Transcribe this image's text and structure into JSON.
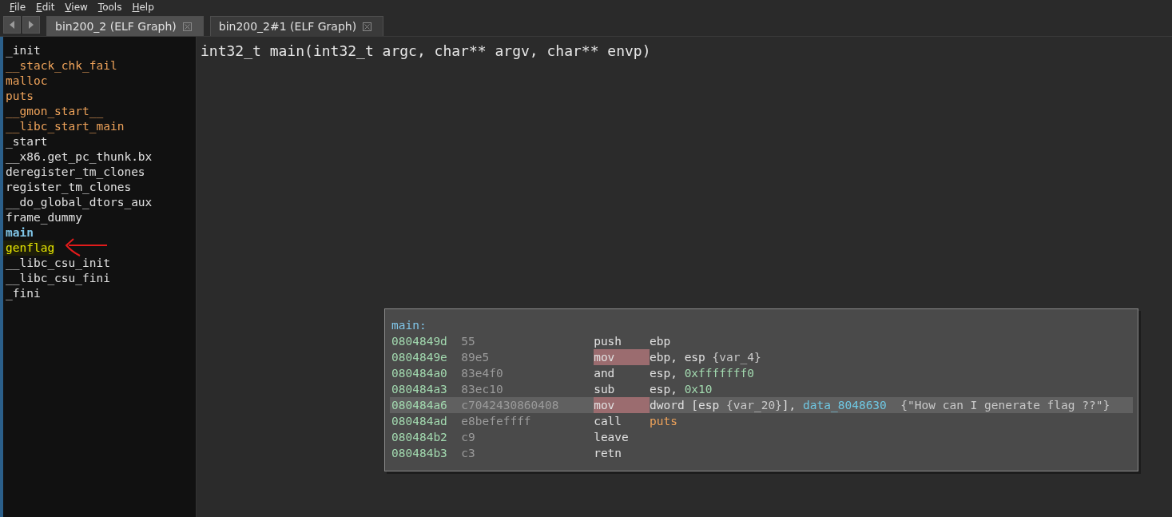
{
  "menu": [
    {
      "label": "File"
    },
    {
      "label": "Edit"
    },
    {
      "label": "View"
    },
    {
      "label": "Tools"
    },
    {
      "label": "Help"
    }
  ],
  "tabs": [
    {
      "label": "bin200_2 (ELF Graph)",
      "selected": true
    },
    {
      "label": "bin200_2#1 (ELF Graph)",
      "selected": false
    }
  ],
  "symbols": [
    {
      "name": "_init",
      "kind": "local",
      "selected": false
    },
    {
      "name": "__stack_chk_fail",
      "kind": "import",
      "selected": false
    },
    {
      "name": "malloc",
      "kind": "import",
      "selected": false
    },
    {
      "name": "puts",
      "kind": "import",
      "selected": false
    },
    {
      "name": "__gmon_start__",
      "kind": "import",
      "selected": false
    },
    {
      "name": "__libc_start_main",
      "kind": "import",
      "selected": false
    },
    {
      "name": "_start",
      "kind": "local",
      "selected": false
    },
    {
      "name": "__x86.get_pc_thunk.bx",
      "kind": "local",
      "selected": false
    },
    {
      "name": "deregister_tm_clones",
      "kind": "local",
      "selected": false
    },
    {
      "name": "register_tm_clones",
      "kind": "local",
      "selected": false
    },
    {
      "name": "__do_global_dtors_aux",
      "kind": "local",
      "selected": false
    },
    {
      "name": "frame_dummy",
      "kind": "local",
      "selected": false
    },
    {
      "name": "main",
      "kind": "local",
      "selected": true
    },
    {
      "name": "genflag",
      "kind": "highlighted",
      "selected": false
    },
    {
      "name": "__libc_csu_init",
      "kind": "local",
      "selected": false
    },
    {
      "name": "__libc_csu_fini",
      "kind": "local",
      "selected": false
    },
    {
      "name": "_fini",
      "kind": "local",
      "selected": false
    }
  ],
  "graph": {
    "signature": "int32_t main(int32_t argc, char** argv, char** envp)",
    "block": {
      "label": "main:",
      "instructions": [
        {
          "address": "0804849d",
          "bytes": "55",
          "mnemonic": "push",
          "highlighted": false,
          "selected": false,
          "operands": [
            {
              "text": "ebp",
              "kind": "reg"
            }
          ]
        },
        {
          "address": "0804849e",
          "bytes": "89e5",
          "mnemonic": "mov",
          "highlighted": true,
          "selected": false,
          "operands": [
            {
              "text": "ebp, esp ",
              "kind": "reg"
            },
            {
              "text": "{var_4}",
              "kind": "var"
            }
          ]
        },
        {
          "address": "080484a0",
          "bytes": "83e4f0",
          "mnemonic": "and",
          "highlighted": false,
          "selected": false,
          "operands": [
            {
              "text": "esp, ",
              "kind": "reg"
            },
            {
              "text": "0xfffffff0",
              "kind": "num"
            }
          ]
        },
        {
          "address": "080484a3",
          "bytes": "83ec10",
          "mnemonic": "sub",
          "highlighted": false,
          "selected": false,
          "operands": [
            {
              "text": "esp, ",
              "kind": "reg"
            },
            {
              "text": "0x10",
              "kind": "num"
            }
          ]
        },
        {
          "address": "080484a6",
          "bytes": "c7042430860408",
          "mnemonic": "mov",
          "highlighted": true,
          "selected": true,
          "operands": [
            {
              "text": "dword [esp ",
              "kind": "reg"
            },
            {
              "text": "{var_20}",
              "kind": "var"
            },
            {
              "text": "], ",
              "kind": "reg"
            },
            {
              "text": "data_8048630",
              "kind": "data"
            },
            {
              "text": "  {\"How can I generate flag ??\"}",
              "kind": "string"
            }
          ]
        },
        {
          "address": "080484ad",
          "bytes": "e8befeffff",
          "mnemonic": "call",
          "highlighted": false,
          "selected": false,
          "operands": [
            {
              "text": "puts",
              "kind": "func"
            }
          ]
        },
        {
          "address": "080484b2",
          "bytes": "c9",
          "mnemonic": "leave",
          "highlighted": false,
          "selected": false
        },
        {
          "address": "080484b3",
          "bytes": "c3",
          "mnemonic": "retn",
          "highlighted": false,
          "selected": false
        }
      ]
    }
  }
}
